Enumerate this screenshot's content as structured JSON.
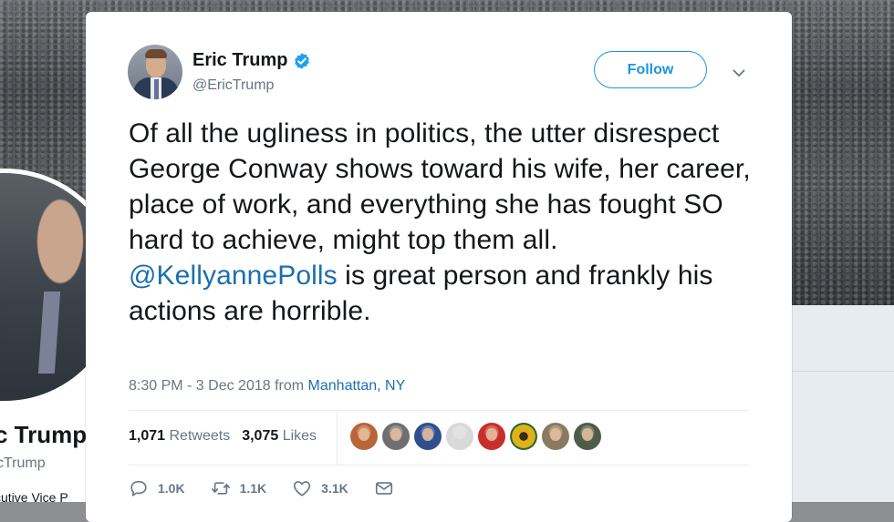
{
  "background": {
    "profile_name_partial": "c Trump",
    "profile_handle_partial": "cTrump",
    "profile_bio_partial": "cutive Vice P"
  },
  "tweet": {
    "author": {
      "display_name": "Eric Trump",
      "handle": "@EricTrump",
      "verified": true
    },
    "follow_label": "Follow",
    "text_before_mention": "Of all the ugliness in politics, the utter disrespect George Conway shows toward his wife, her career, place of work, and everything she has fought SO hard to achieve, might top them all. ",
    "mention": "@KellyannePolls",
    "text_after_mention": " is great person and frankly his actions are horrible.",
    "timestamp": "8:30 PM - 3 Dec 2018",
    "from_label": "from",
    "location": "Manhattan, NY",
    "retweet_count": "1,071",
    "retweet_label": "Retweets",
    "like_count": "3,075",
    "like_label": "Likes",
    "likers": [
      {
        "icon": "avatar-1",
        "color": "#b8653a"
      },
      {
        "icon": "avatar-2",
        "color": "#6f6f6f"
      },
      {
        "icon": "avatar-3",
        "color": "#2f4f8f"
      },
      {
        "icon": "avatar-4",
        "color": "#d9d9d9"
      },
      {
        "icon": "avatar-5",
        "color": "#c7302a"
      },
      {
        "icon": "avatar-6",
        "color": "#e0b21a"
      },
      {
        "icon": "avatar-7",
        "color": "#8a7a62"
      },
      {
        "icon": "avatar-8",
        "color": "#4d5d4a"
      }
    ],
    "actions": {
      "reply_count": "1.0K",
      "retweet_count": "1.1K",
      "like_count": "3.1K"
    }
  },
  "colors": {
    "accent": "#1b95e0",
    "link": "#1b6fb0",
    "text": "#14171a",
    "secondary": "#657786"
  }
}
